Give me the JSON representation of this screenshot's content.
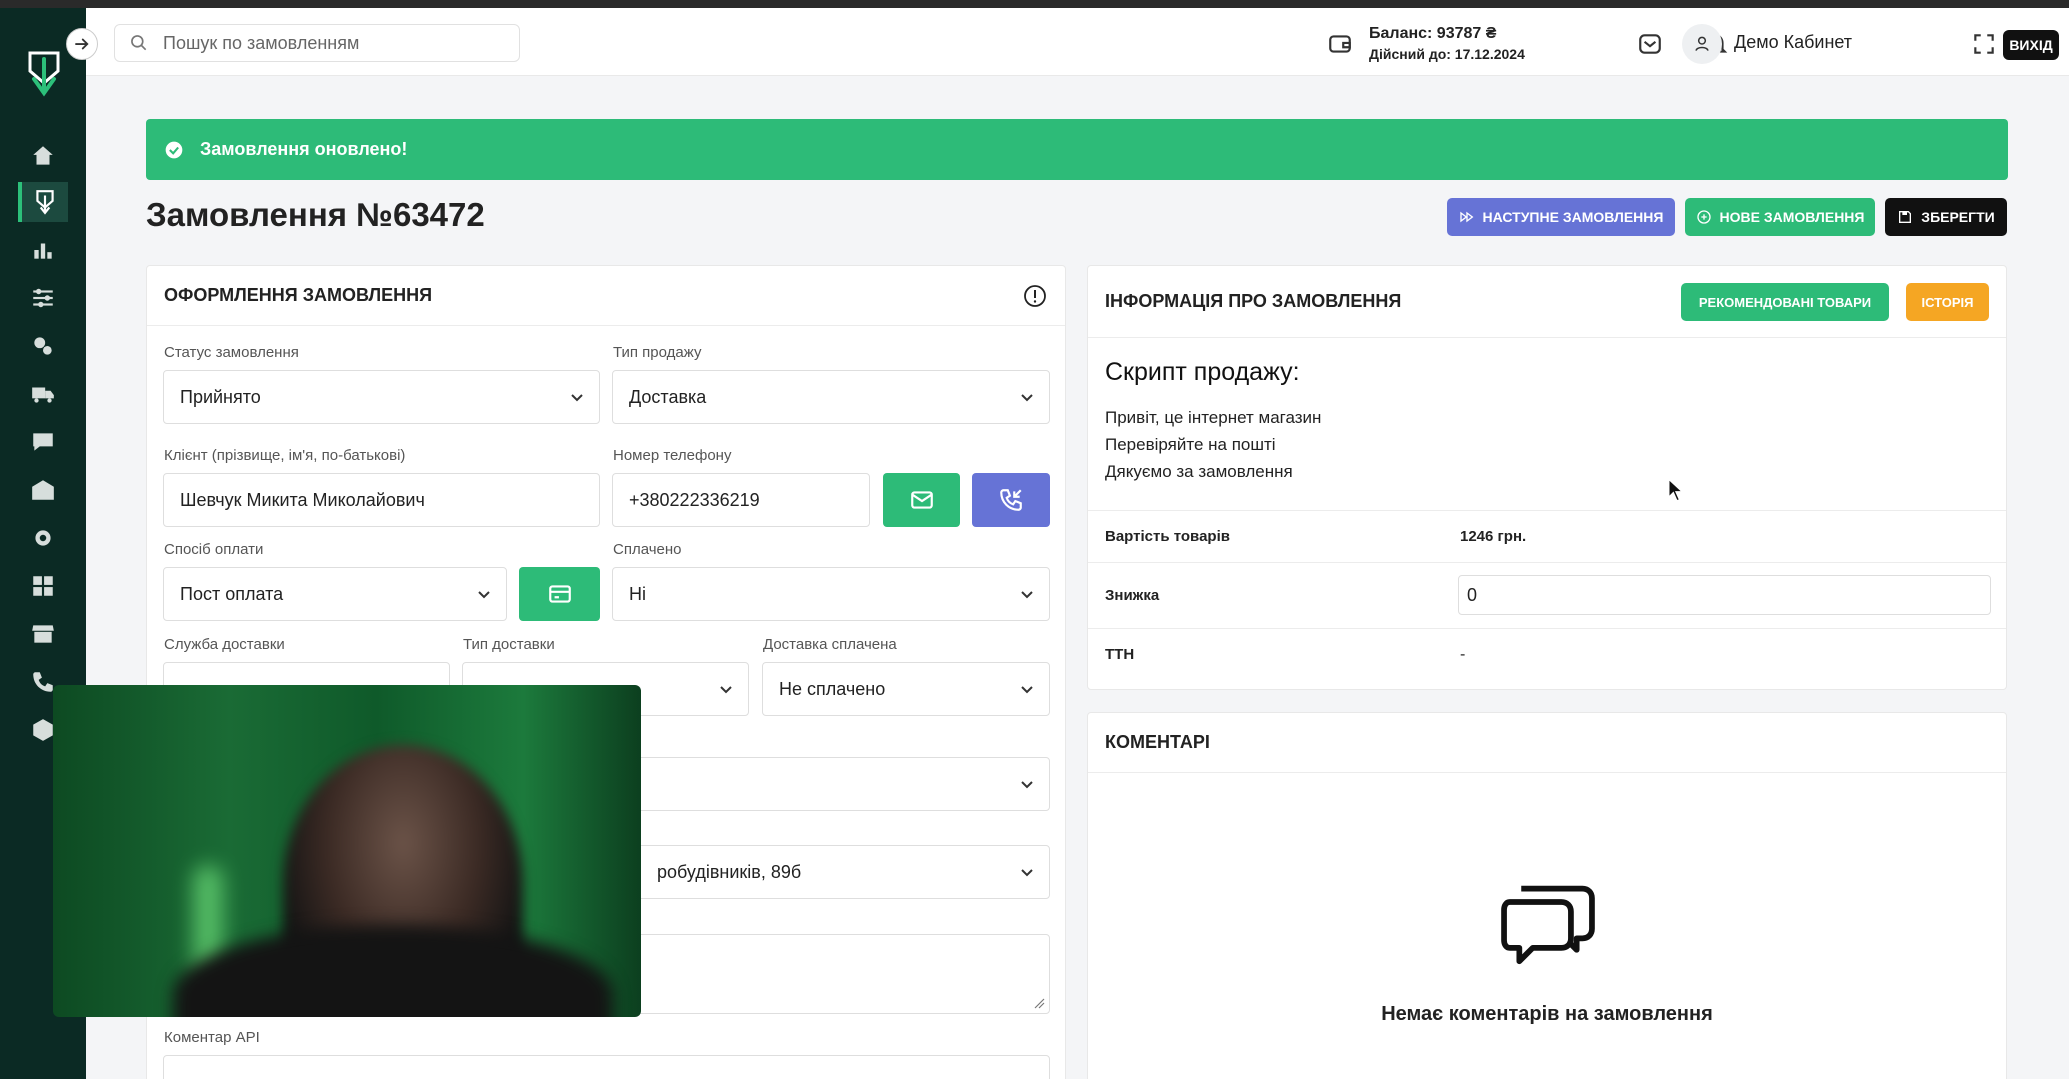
{
  "search": {
    "placeholder": "Пошук по замовленням"
  },
  "header": {
    "balance_label": "Баланс: 93787 ₴",
    "valid_until": "Дійсний до: 17.12.2024",
    "user_name": "Демо Кабинет",
    "exit_label": "ВИХІД"
  },
  "sidebar": {
    "items": [
      {
        "icon": "home-icon"
      },
      {
        "icon": "orders-icon"
      },
      {
        "icon": "analytics-icon"
      },
      {
        "icon": "filters-icon"
      },
      {
        "icon": "integrations-icon"
      },
      {
        "icon": "delivery-icon"
      },
      {
        "icon": "chat-icon"
      },
      {
        "icon": "warehouse-icon"
      },
      {
        "icon": "settings-icon"
      },
      {
        "icon": "dashboard-icon"
      },
      {
        "icon": "store-icon"
      },
      {
        "icon": "phone-icon"
      },
      {
        "icon": "products-icon"
      }
    ]
  },
  "alert": {
    "message": "Замовлення оновлено!"
  },
  "page": {
    "title": "Замовлення №63472"
  },
  "actions": {
    "next_order": "НАСТУПНЕ ЗАМОВЛЕННЯ",
    "new_order": "НОВЕ ЗАМОВЛЕННЯ",
    "save": "ЗБЕРЕГТИ"
  },
  "order_form": {
    "title": "ОФОРМЛЕННЯ ЗАМОВЛЕННЯ",
    "status_label": "Статус замовлення",
    "status_value": "Прийнято",
    "sale_type_label": "Тип продажу",
    "sale_type_value": "Доставка",
    "client_label": "Клієнт (прізвище, ім'я, по-батькові)",
    "client_value": "Шевчук Микита Миколайович",
    "phone_label": "Номер телефону",
    "phone_value": "+380222336219",
    "payment_method_label": "Спосіб оплати",
    "payment_method_value": "Пост оплата",
    "paid_label": "Сплачено",
    "paid_value": "Ні",
    "delivery_service_label": "Служба доставки",
    "delivery_type_label": "Тип доставки",
    "delivery_paid_label": "Доставка сплачена",
    "delivery_paid_value": "Не сплачено",
    "address_partial": "робудівників, 89б",
    "api_comment_label": "Коментар API"
  },
  "order_info": {
    "title": "ІНФОРМАЦІЯ ПРО ЗАМОВЛЕННЯ",
    "recommended_btn": "РЕКОМЕНДОВАНІ ТОВАРИ",
    "history_btn": "ІСТОРІЯ",
    "script_title": "Скрипт продажу:",
    "script_lines": [
      "Привіт, це інтернет магазин",
      "Перевіряйте на пошті",
      "Дякуємо за замовлення"
    ],
    "goods_cost_label": "Вартість товарів",
    "goods_cost_value": "1246 грн.",
    "discount_label": "Знижка",
    "discount_value": "0",
    "ttn_label": "ТТН",
    "ttn_value": "-"
  },
  "comments": {
    "title": "КОМЕНТАРІ",
    "empty_text": "Немає коментарів на замовлення"
  },
  "colors": {
    "sidebar_bg": "#0b2a24",
    "success": "#2dbb78",
    "primary_purple": "#6673d6",
    "warning_orange": "#f5a623",
    "dark": "#111111"
  }
}
